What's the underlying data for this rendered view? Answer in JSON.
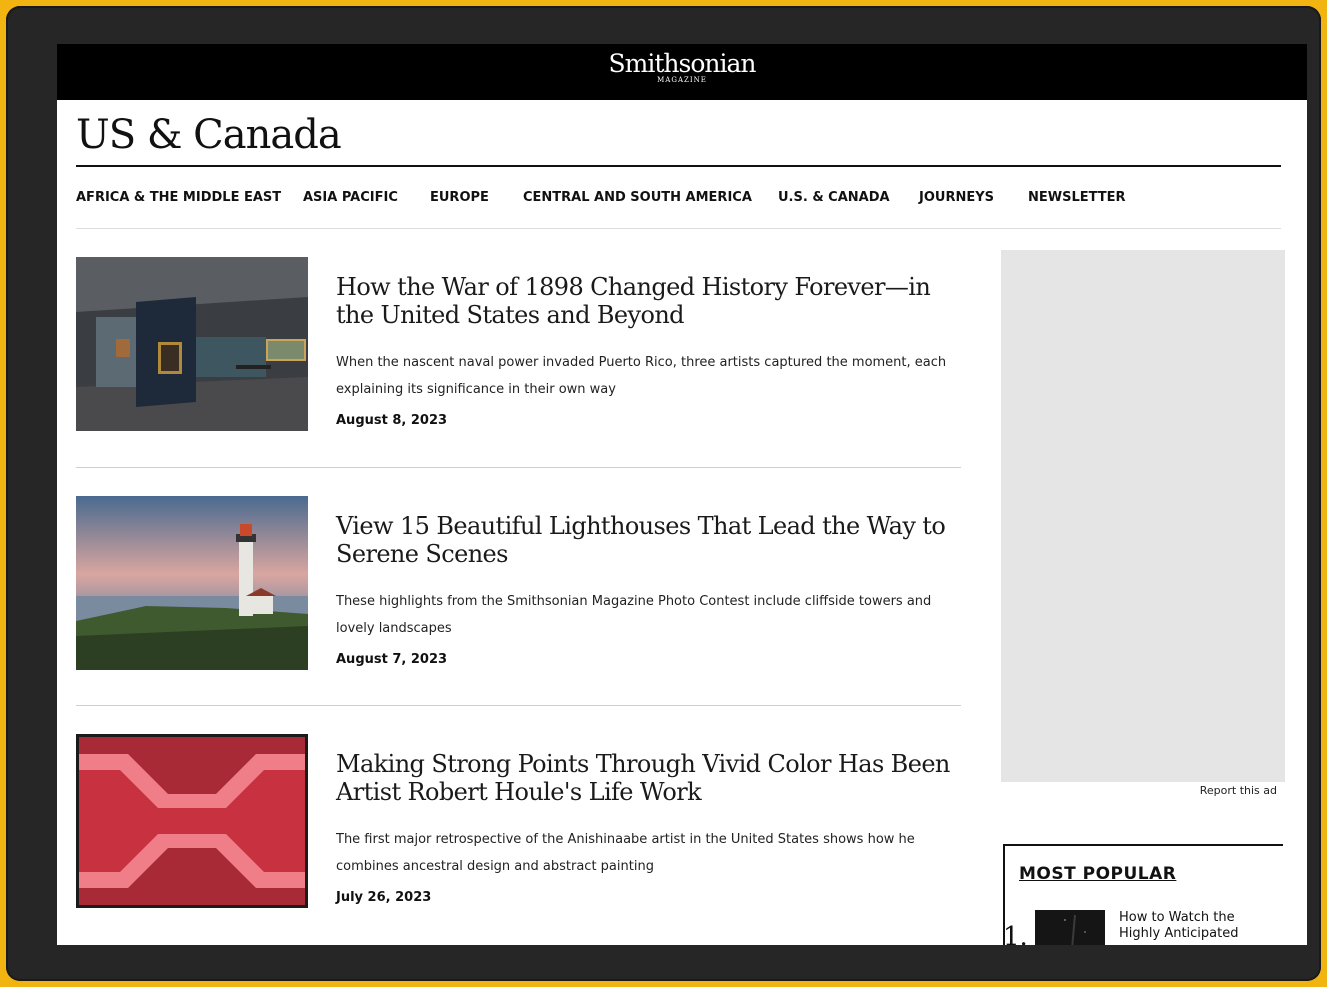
{
  "header": {
    "logo_name": "Smithsonian",
    "logo_sub": "MAGAZINE"
  },
  "section": {
    "title": "US & Canada"
  },
  "nav": {
    "items": [
      {
        "label": "AFRICA & THE MIDDLE EAST"
      },
      {
        "label": "ASIA PACIFIC"
      },
      {
        "label": "EUROPE"
      },
      {
        "label": "CENTRAL AND SOUTH AMERICA"
      },
      {
        "label": "U.S. & CANADA"
      },
      {
        "label": "JOURNEYS"
      },
      {
        "label": "NEWSLETTER"
      }
    ]
  },
  "articles": [
    {
      "title": "How the War of 1898 Changed History Forever—in the United States and Beyond",
      "description": "When the nascent naval power invaded Puerto Rico, three artists captured the moment, each explaining its significance in their own way",
      "date": "August 8, 2023"
    },
    {
      "title": "View 15 Beautiful Lighthouses That Lead the Way to Serene Scenes",
      "description": "These highlights from the Smithsonian Magazine Photo Contest include cliffside towers and lovely landscapes",
      "date": "August 7, 2023"
    },
    {
      "title": "Making Strong Points Through Vivid Color Has Been Artist Robert Houle's Life Work",
      "description": "The first major retrospective of the Anishinaabe artist in the United States shows how he combines ancestral design and abstract painting",
      "date": "July 26, 2023"
    }
  ],
  "sidebar": {
    "report_ad": "Report this ad",
    "most_popular_title": "MOST POPULAR",
    "popular_items": [
      {
        "rank": "1.",
        "title": "How to Watch the Highly Anticipated"
      }
    ]
  },
  "colors": {
    "frame": "#f2b410",
    "device": "#262626",
    "topbar": "#000000",
    "ad_placeholder": "#e5e5e5"
  }
}
